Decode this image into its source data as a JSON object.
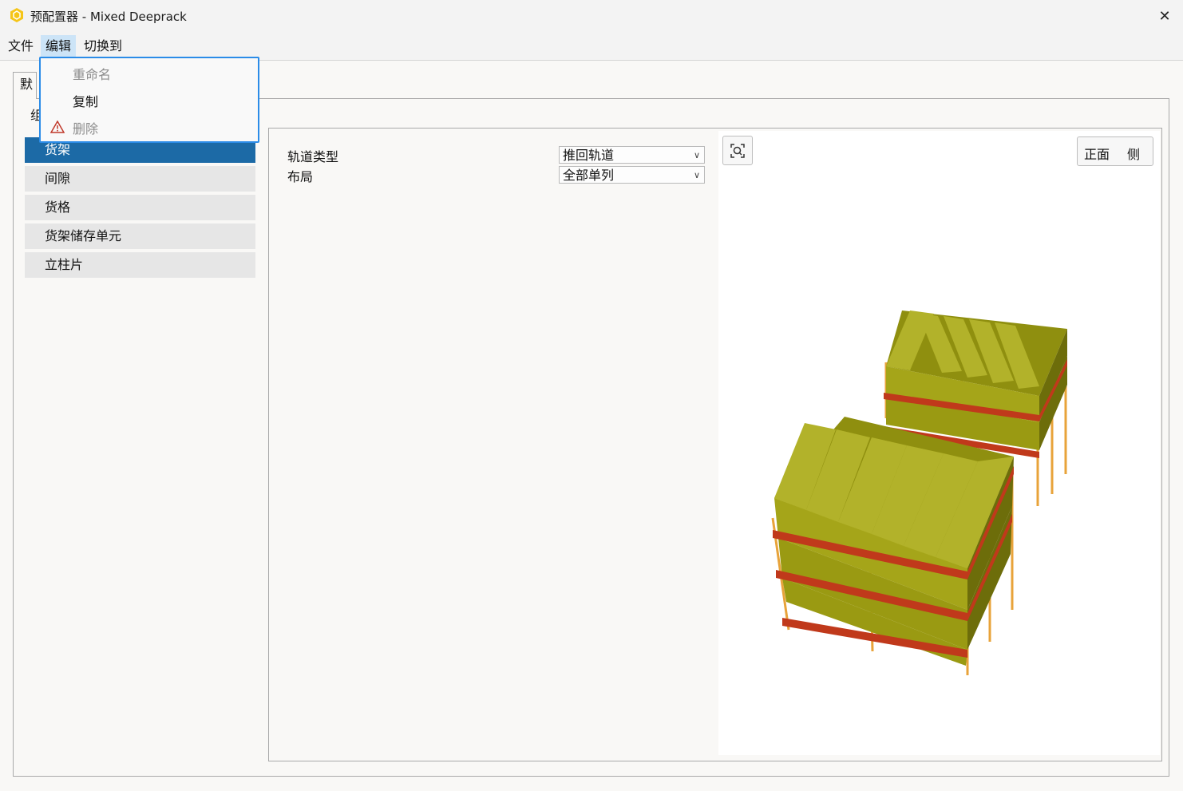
{
  "window": {
    "title": "预配置器 - Mixed Deeprack",
    "close_glyph": "✕"
  },
  "menubar": {
    "items": [
      "文件",
      "编辑",
      "切换到"
    ],
    "active_index": 1
  },
  "tabs": {
    "outer": "默认",
    "inner": "组"
  },
  "sidebar": {
    "items": [
      {
        "label": "货架",
        "selected": true
      },
      {
        "label": "间隙",
        "selected": false
      },
      {
        "label": "货格",
        "selected": false
      },
      {
        "label": "货架储存单元",
        "selected": false
      },
      {
        "label": "立柱片",
        "selected": false
      }
    ]
  },
  "properties": [
    {
      "label": "轨道类型",
      "value": "推回轨道"
    },
    {
      "label": "布局",
      "value": "全部单列"
    }
  ],
  "viewer": {
    "zoom_icon": "zoom-fit-icon",
    "front_label": "正面",
    "side_label": "侧"
  },
  "dropdown_menu": {
    "items": [
      {
        "label": "重命名",
        "enabled": false
      },
      {
        "label": "复制",
        "enabled": true
      },
      {
        "label": "删除",
        "enabled": false,
        "icon": "warning-icon"
      }
    ]
  },
  "colors": {
    "accent": "#1c6aa6",
    "menu_border": "#2b8ce8",
    "box": "#9a9a12",
    "beam": "#c0391b",
    "upright": "#e8a33a"
  }
}
